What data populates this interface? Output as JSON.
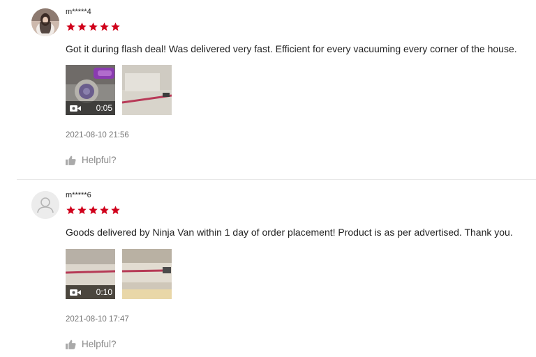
{
  "reviews": [
    {
      "username": "m*****4",
      "rating": 5,
      "comment": "Got it during flash deal! Was delivered very fast. Efficient for every vacuuming every corner of the house.",
      "video_duration": "0:05",
      "timestamp": "2021-08-10 21:56",
      "helpful_label": "Helpful?"
    },
    {
      "username": "m*****6",
      "rating": 5,
      "comment": "Goods delivered by Ninja Van within 1 day of order placement! Product is as per advertised. Thank you.",
      "video_duration": "0:10",
      "timestamp": "2021-08-10 17:47",
      "helpful_label": "Helpful?"
    }
  ],
  "icons": {
    "star": "star-icon",
    "video": "video-camera-icon",
    "helpful": "thumbs-up-icon",
    "default_avatar": "user-silhouette-icon"
  },
  "colors": {
    "star": "#d0011b",
    "muted_text": "#888888",
    "divider": "#e8e8e8"
  }
}
